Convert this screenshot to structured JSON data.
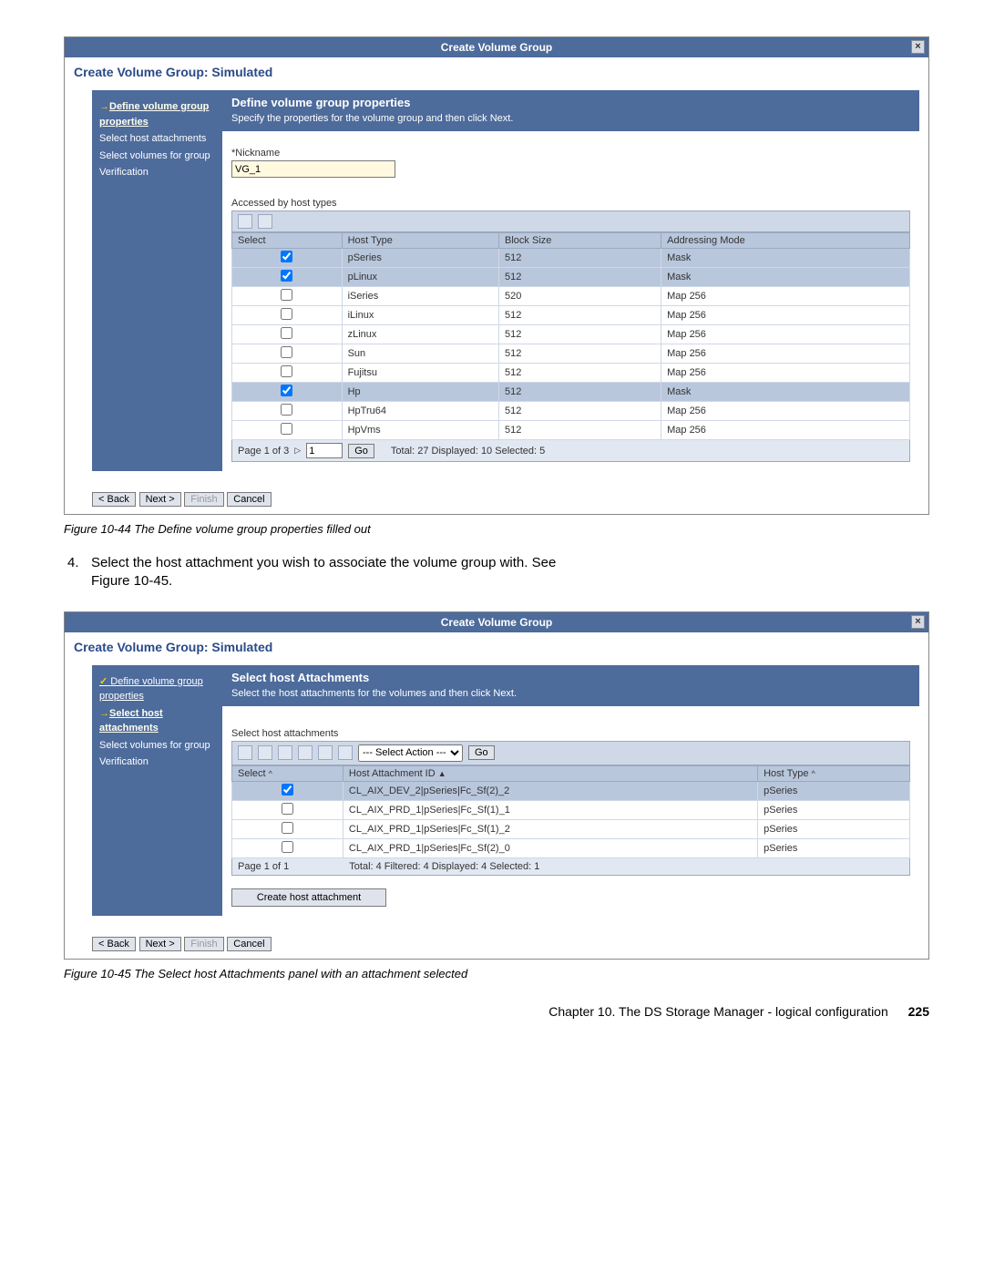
{
  "fig1": {
    "title": "Create Volume Group",
    "subtitle": "Create Volume Group: Simulated",
    "steps": {
      "s1": "Define volume group properties",
      "s2": "Select host attachments",
      "s3": "Select volumes for group",
      "s4": "Verification"
    },
    "pane": {
      "heading": "Define volume group properties",
      "desc": "Specify the properties for the volume group and then click Next.",
      "nick_label": "*Nickname",
      "nick_value": "VG_1",
      "acc_label": "Accessed by host types"
    },
    "cols": {
      "c1": "Select",
      "c2": "Host Type",
      "c3": "Block Size",
      "c4": "Addressing Mode"
    },
    "rows": [
      {
        "sel": true,
        "ht": "pSeries",
        "bs": "512",
        "am": "Mask"
      },
      {
        "sel": true,
        "ht": "pLinux",
        "bs": "512",
        "am": "Mask"
      },
      {
        "sel": false,
        "ht": "iSeries",
        "bs": "520",
        "am": "Map 256"
      },
      {
        "sel": false,
        "ht": "iLinux",
        "bs": "512",
        "am": "Map 256"
      },
      {
        "sel": false,
        "ht": "zLinux",
        "bs": "512",
        "am": "Map 256"
      },
      {
        "sel": false,
        "ht": "Sun",
        "bs": "512",
        "am": "Map 256"
      },
      {
        "sel": false,
        "ht": "Fujitsu",
        "bs": "512",
        "am": "Map 256"
      },
      {
        "sel": true,
        "ht": "Hp",
        "bs": "512",
        "am": "Mask"
      },
      {
        "sel": false,
        "ht": "HpTru64",
        "bs": "512",
        "am": "Map 256"
      },
      {
        "sel": false,
        "ht": "HpVms",
        "bs": "512",
        "am": "Map 256"
      }
    ],
    "pager": {
      "page_label": "Page 1 of 3",
      "num": "1",
      "go": "Go",
      "status": "Total: 27   Displayed: 10   Selected: 5"
    },
    "buttons": {
      "back": "< Back",
      "next": "Next >",
      "finish": "Finish",
      "cancel": "Cancel"
    },
    "caption": "Figure 10-44   The Define volume group properties filled out"
  },
  "bodytext": {
    "num": "4.",
    "line1": "Select the host attachment you wish to associate the volume group with. See",
    "line2": "Figure 10-45."
  },
  "fig2": {
    "title": "Create Volume Group",
    "subtitle": "Create Volume Group: Simulated",
    "steps": {
      "s1": "Define volume group properties",
      "s2": "Select host attachments",
      "s3": "Select volumes for group",
      "s4": "Verification"
    },
    "pane": {
      "heading": "Select host Attachments",
      "desc": "Select the host attachments for the volumes and then click Next.",
      "sha_label": "Select host attachments",
      "action_placeholder": "--- Select Action ---",
      "go": "Go"
    },
    "cols": {
      "c1": "Select",
      "c2": "Host Attachment ID",
      "c3": "Host Type"
    },
    "rows": [
      {
        "sel": true,
        "id": "CL_AIX_DEV_2|pSeries|Fc_Sf(2)_2",
        "ht": "pSeries"
      },
      {
        "sel": false,
        "id": "CL_AIX_PRD_1|pSeries|Fc_Sf(1)_1",
        "ht": "pSeries"
      },
      {
        "sel": false,
        "id": "CL_AIX_PRD_1|pSeries|Fc_Sf(1)_2",
        "ht": "pSeries"
      },
      {
        "sel": false,
        "id": "CL_AIX_PRD_1|pSeries|Fc_Sf(2)_0",
        "ht": "pSeries"
      }
    ],
    "pager": {
      "page_label": "Page 1 of 1",
      "status": "Total: 4   Filtered: 4   Displayed: 4   Selected: 1"
    },
    "create_btn": "Create host attachment",
    "buttons": {
      "back": "< Back",
      "next": "Next >",
      "finish": "Finish",
      "cancel": "Cancel"
    },
    "caption": "Figure 10-45   The Select host Attachments panel with an attachment selected"
  },
  "footer": {
    "chapter": "Chapter 10. The DS Storage Manager - logical configuration",
    "page": "225"
  }
}
